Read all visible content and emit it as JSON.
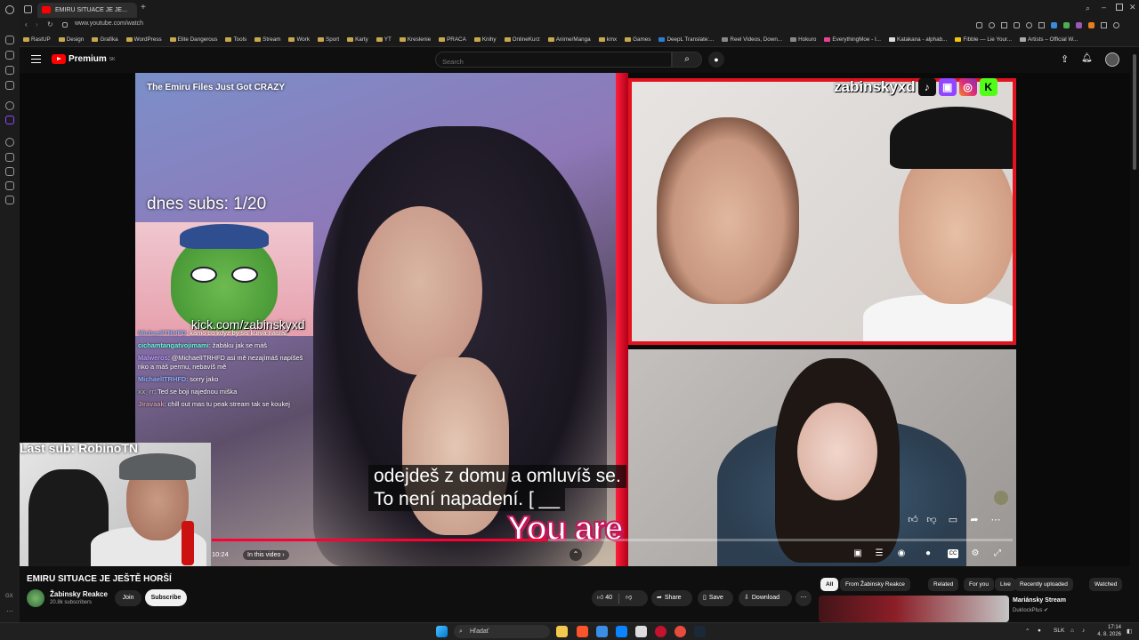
{
  "browser": {
    "tab_title": "EMIRU SITUACE JE JE...",
    "url": "www.youtube.com/watch",
    "bookmarks": [
      "RastUP",
      "Design",
      "Grafika",
      "WordPress",
      "Elite Dangerous",
      "Tools",
      "Stream",
      "Work",
      "Sport",
      "Karty",
      "YT",
      "Kreslenie",
      "PRACA",
      "Knihy",
      "OnlineKurz",
      "Anime/Manga",
      "kmx",
      "Games",
      "DeepL Translate:...",
      "Reel Videos, Down...",
      "Hokuro",
      "EverythingMoe - I...",
      "Katakana - alphab...",
      "Fibble — Lie Your...",
      "Artists – Official W..."
    ]
  },
  "youtube": {
    "logo_text": "Premium",
    "logo_sup": "SK",
    "search_placeholder": "Search"
  },
  "video": {
    "overlay_title": "The Emiru Files Just Got CRAZY",
    "subs_count": "dnes subs: 1/20",
    "kick_url": "kick.com/zabinskyxd",
    "streamer_tag": "zabinskyxd",
    "last_sub": "Last sub: RobinoTN",
    "chat": [
      {
        "user": "MichaelITRHFD",
        "msg": ": kamo co kdyz by sis kurva nasral"
      },
      {
        "user": "cichamtangatvojimami",
        "msg": ": žabáku jak se máš"
      },
      {
        "user": "Malweros",
        "msg": ": @MichaelITRHFD asi mě nezajímáš napíšeš nko a máš permu, nebavíš mě"
      },
      {
        "user": "MichaelITRHFD",
        "msg": ": sorry jako"
      },
      {
        "user": "xx_rr",
        "msg": ": Ted se boji najednou miška"
      },
      {
        "user": "Jiravaak",
        "msg": ": chill out mas tu peak stream tak se koukej"
      }
    ],
    "caption_line1": "odejdeš z domu a omluvíš se.",
    "caption_line2": "To není napadení.  [ __",
    "overlay_text": "You are",
    "current_time": "10:24",
    "in_this_video": "In this video",
    "progress": 0.42
  },
  "below": {
    "title": "EMIRU SITUACE JE JEŠTĚ HORŠÍ",
    "channel": "Žabinsky Reakce",
    "channel_subs": "20.8k subscribers",
    "join": "Join",
    "subscribe": "Subscribe",
    "likes": "40",
    "share": "Share",
    "save": "Save",
    "download": "Download",
    "chips": [
      "All",
      "From Žabinsky Reakce",
      "Related",
      "For you",
      "Live",
      "Recently uploaded",
      "Watched"
    ],
    "rec_title": "Mariánsky Stream",
    "rec_channel": "DukIockPlus"
  },
  "taskbar": {
    "search": "Hľadať",
    "lang": "SLK",
    "time": "17:14",
    "date": "4. 8. 2026"
  }
}
